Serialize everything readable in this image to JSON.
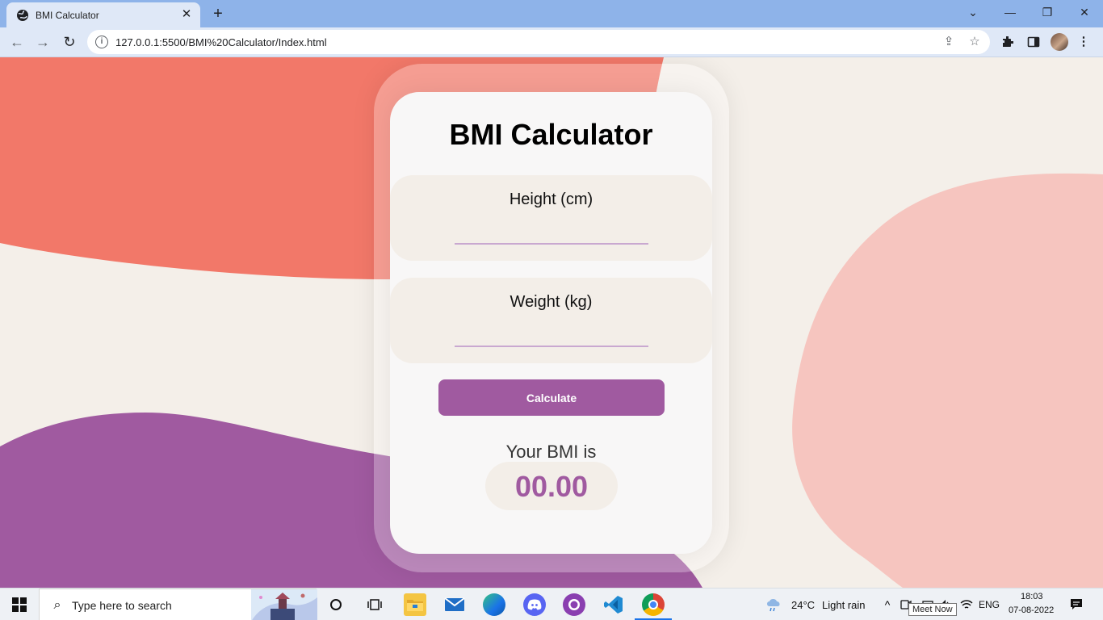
{
  "browser": {
    "tab_title": "BMI Calculator",
    "tab_close": "✕",
    "new_tab": "+",
    "url": "127.0.0.1:5500/BMI%20Calculator/Index.html",
    "window_controls": {
      "dropdown": "⌄",
      "minimize": "—",
      "restore": "❐",
      "close": "✕"
    },
    "nav": {
      "back": "←",
      "forward": "→",
      "reload": "↻"
    }
  },
  "app": {
    "title": "BMI Calculator",
    "height_label": "Height (cm)",
    "height_value": "",
    "weight_label": "Weight (kg)",
    "weight_value": "",
    "calculate_label": "Calculate",
    "result_label": "Your BMI is",
    "result_value": "00.00",
    "colors": {
      "accent": "#a05aa0",
      "coral": "#f26a5b",
      "peach": "#f6c5bf",
      "cream": "#f4efe9"
    }
  },
  "taskbar": {
    "search_placeholder": "Type here to search",
    "weather_temp": "24°C",
    "weather_desc": "Light rain",
    "language": "ENG",
    "time": "18:03",
    "date": "07-08-2022",
    "tooltip": "Meet Now",
    "icons": [
      "windows-start-icon",
      "search-icon",
      "cortana-icon",
      "task-view-icon",
      "file-explorer-icon",
      "mail-icon",
      "edge-icon",
      "discord-icon",
      "github-desktop-icon",
      "vscode-icon",
      "chrome-icon"
    ]
  }
}
